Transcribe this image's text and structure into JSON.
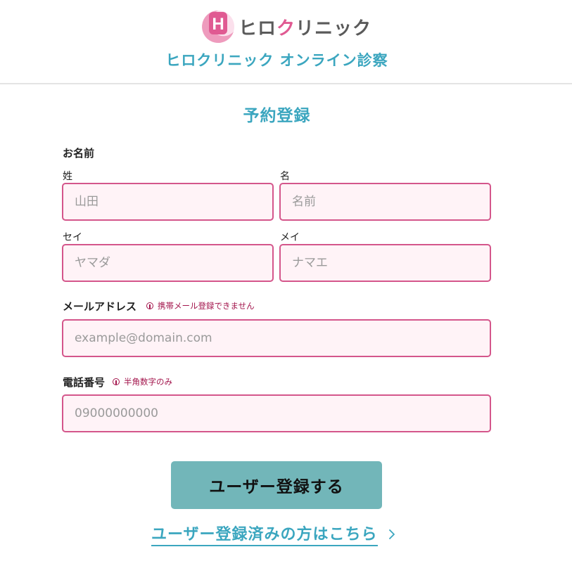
{
  "header": {
    "logo_letter": "H",
    "logo_text_1": "ヒロ",
    "logo_text_2": "ク",
    "logo_text_3": "リニック",
    "site_title": "ヒロクリニック オンライン診察",
    "brand_pink": "#e05a92",
    "brand_teal": "#3ba6bf"
  },
  "form": {
    "title": "予約登録",
    "name": {
      "label": "お名前",
      "last_name": {
        "label": "姓",
        "placeholder": "山田",
        "value": ""
      },
      "first_name": {
        "label": "名",
        "placeholder": "名前",
        "value": ""
      },
      "last_name_kana": {
        "label": "セイ",
        "placeholder": "ヤマダ",
        "value": ""
      },
      "first_name_kana": {
        "label": "メイ",
        "placeholder": "ナマエ",
        "value": ""
      }
    },
    "email": {
      "label": "メールアドレス",
      "note": "携帯メール登録できません",
      "placeholder": "example@domain.com",
      "value": ""
    },
    "phone": {
      "label": "電話番号",
      "note": "半角数字のみ",
      "placeholder": "09000000000",
      "value": ""
    },
    "submit_label": "ユーザー登録する",
    "login_link_label": "ユーザー登録済みの方はこちら",
    "field_border_color": "#d4568b",
    "field_bg_color": "#fff3f7",
    "note_color": "#a3154c",
    "button_color": "#72b6b9"
  },
  "icons": {
    "logo": "clinic-logo-icon",
    "warning": "info-circle-icon",
    "link_arrow": "chevron-right-icon"
  }
}
